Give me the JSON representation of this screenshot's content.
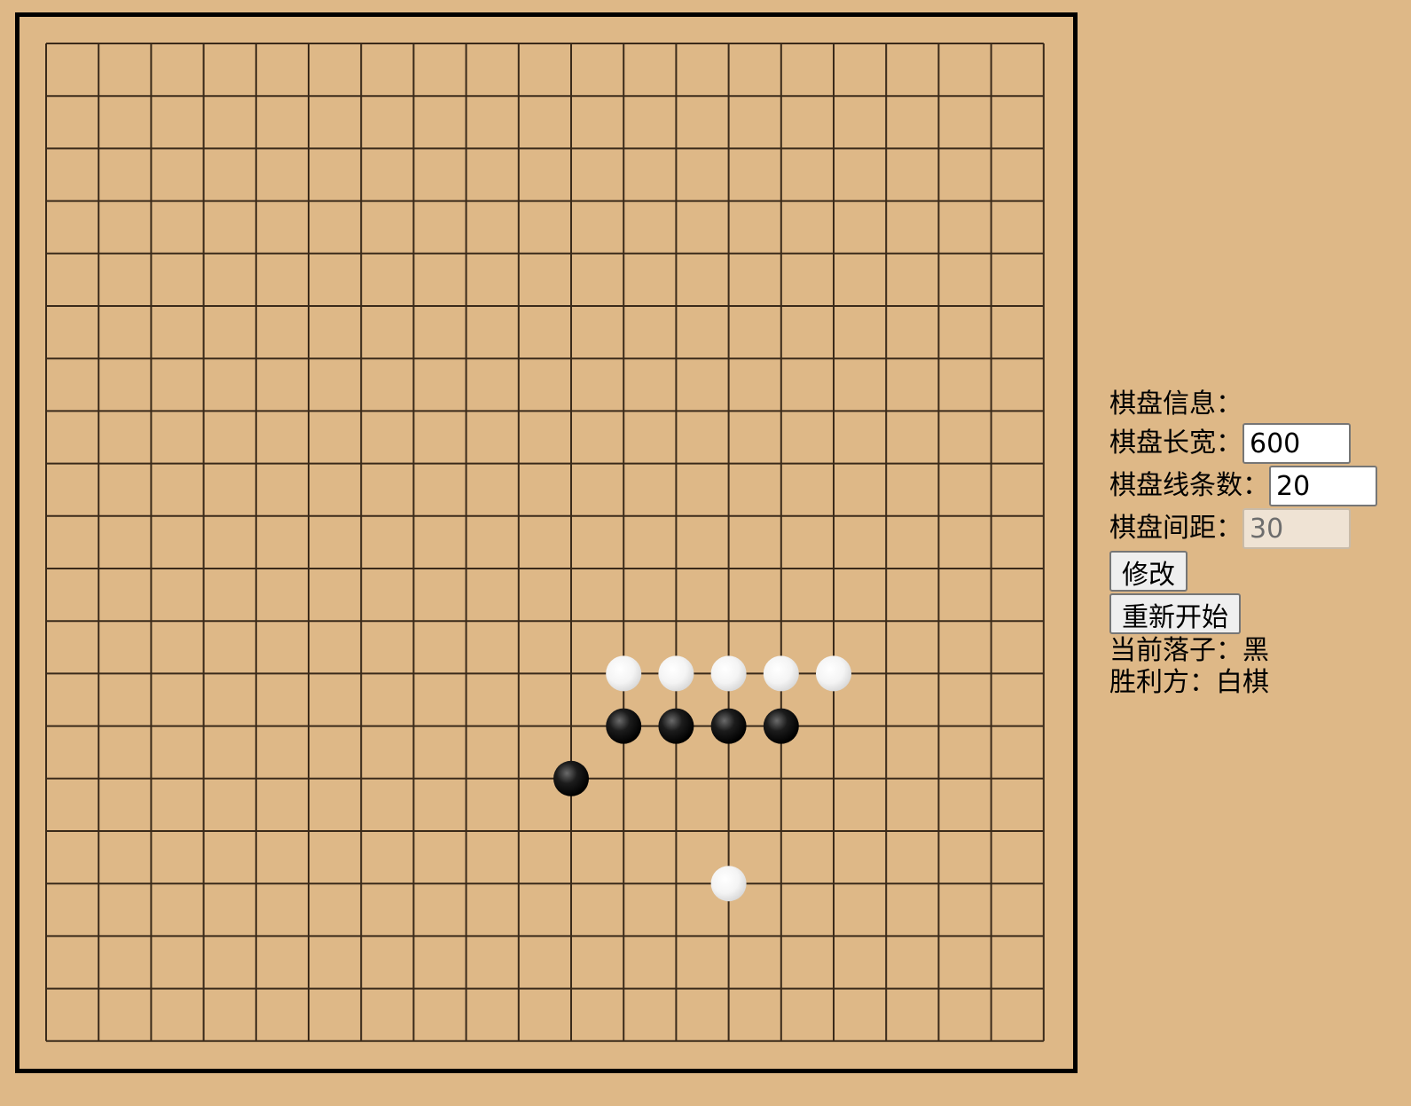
{
  "board": {
    "lines": 20,
    "stones": [
      {
        "col": 11,
        "row": 12,
        "color": "white"
      },
      {
        "col": 12,
        "row": 12,
        "color": "white"
      },
      {
        "col": 13,
        "row": 12,
        "color": "white"
      },
      {
        "col": 14,
        "row": 12,
        "color": "white"
      },
      {
        "col": 15,
        "row": 12,
        "color": "white"
      },
      {
        "col": 11,
        "row": 13,
        "color": "black"
      },
      {
        "col": 12,
        "row": 13,
        "color": "black"
      },
      {
        "col": 13,
        "row": 13,
        "color": "black"
      },
      {
        "col": 14,
        "row": 13,
        "color": "black"
      },
      {
        "col": 10,
        "row": 14,
        "color": "black"
      },
      {
        "col": 13,
        "row": 16,
        "color": "white"
      }
    ]
  },
  "panel": {
    "info_label": "棋盘信息：",
    "size_label": "棋盘长宽：",
    "size_value": "600",
    "lines_label": "棋盘线条数：",
    "lines_value": "20",
    "spacing_label": "棋盘间距：",
    "spacing_value": "30",
    "modify_button": "修改",
    "restart_button": "重新开始",
    "current_label": "当前落子：",
    "current_value": "黑",
    "winner_label": "胜利方：",
    "winner_value": "白棋"
  },
  "colors": {
    "background": "#deb887",
    "grid_line": "#3a2a1a",
    "frame": "#000000"
  }
}
